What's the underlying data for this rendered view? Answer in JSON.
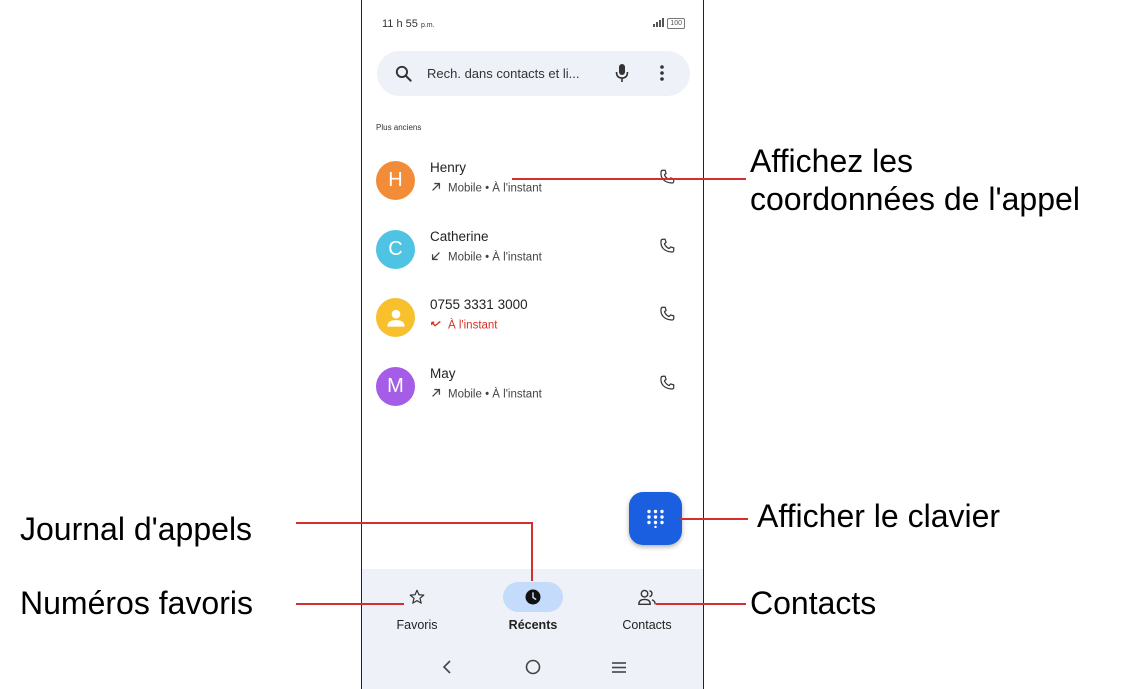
{
  "status_bar": {
    "time": "11 h 55",
    "ampm": "p.m.",
    "battery": "100"
  },
  "search": {
    "placeholder": "Rech. dans contacts et li..."
  },
  "section_header": "Plus anciens",
  "calls": [
    {
      "name": "Henry",
      "initial": "H",
      "avatar_color": "#f28c38",
      "direction": "outgoing",
      "detail": "Mobile • À l'instant",
      "missed": false
    },
    {
      "name": "Catherine",
      "initial": "C",
      "avatar_color": "#4fc3e3",
      "direction": "incoming",
      "detail": "Mobile • À l'instant",
      "missed": false
    },
    {
      "name": "0755 3331 3000",
      "initial": "",
      "avatar_color": "#f7c02c",
      "direction": "missed",
      "detail": "À l'instant",
      "missed": true
    },
    {
      "name": "May",
      "initial": "M",
      "avatar_color": "#a55ce6",
      "direction": "outgoing",
      "detail": "Mobile • À l'instant",
      "missed": false
    }
  ],
  "bottom_nav": {
    "favorites_label": "Favoris",
    "recents_label": "Récents",
    "contacts_label": "Contacts",
    "active": "recents"
  },
  "callouts": {
    "call_details": "Affichez les\ncoordonnées de l'appel",
    "dialpad": "Afficher le clavier",
    "call_log": "Journal d'appels",
    "favorites": "Numéros favoris",
    "contacts": "Contacts"
  },
  "colors": {
    "fab": "#1a5fe0",
    "annotation_line": "#d32f2f",
    "missed": "#d93025",
    "nav_active": "#c5dbfb"
  }
}
